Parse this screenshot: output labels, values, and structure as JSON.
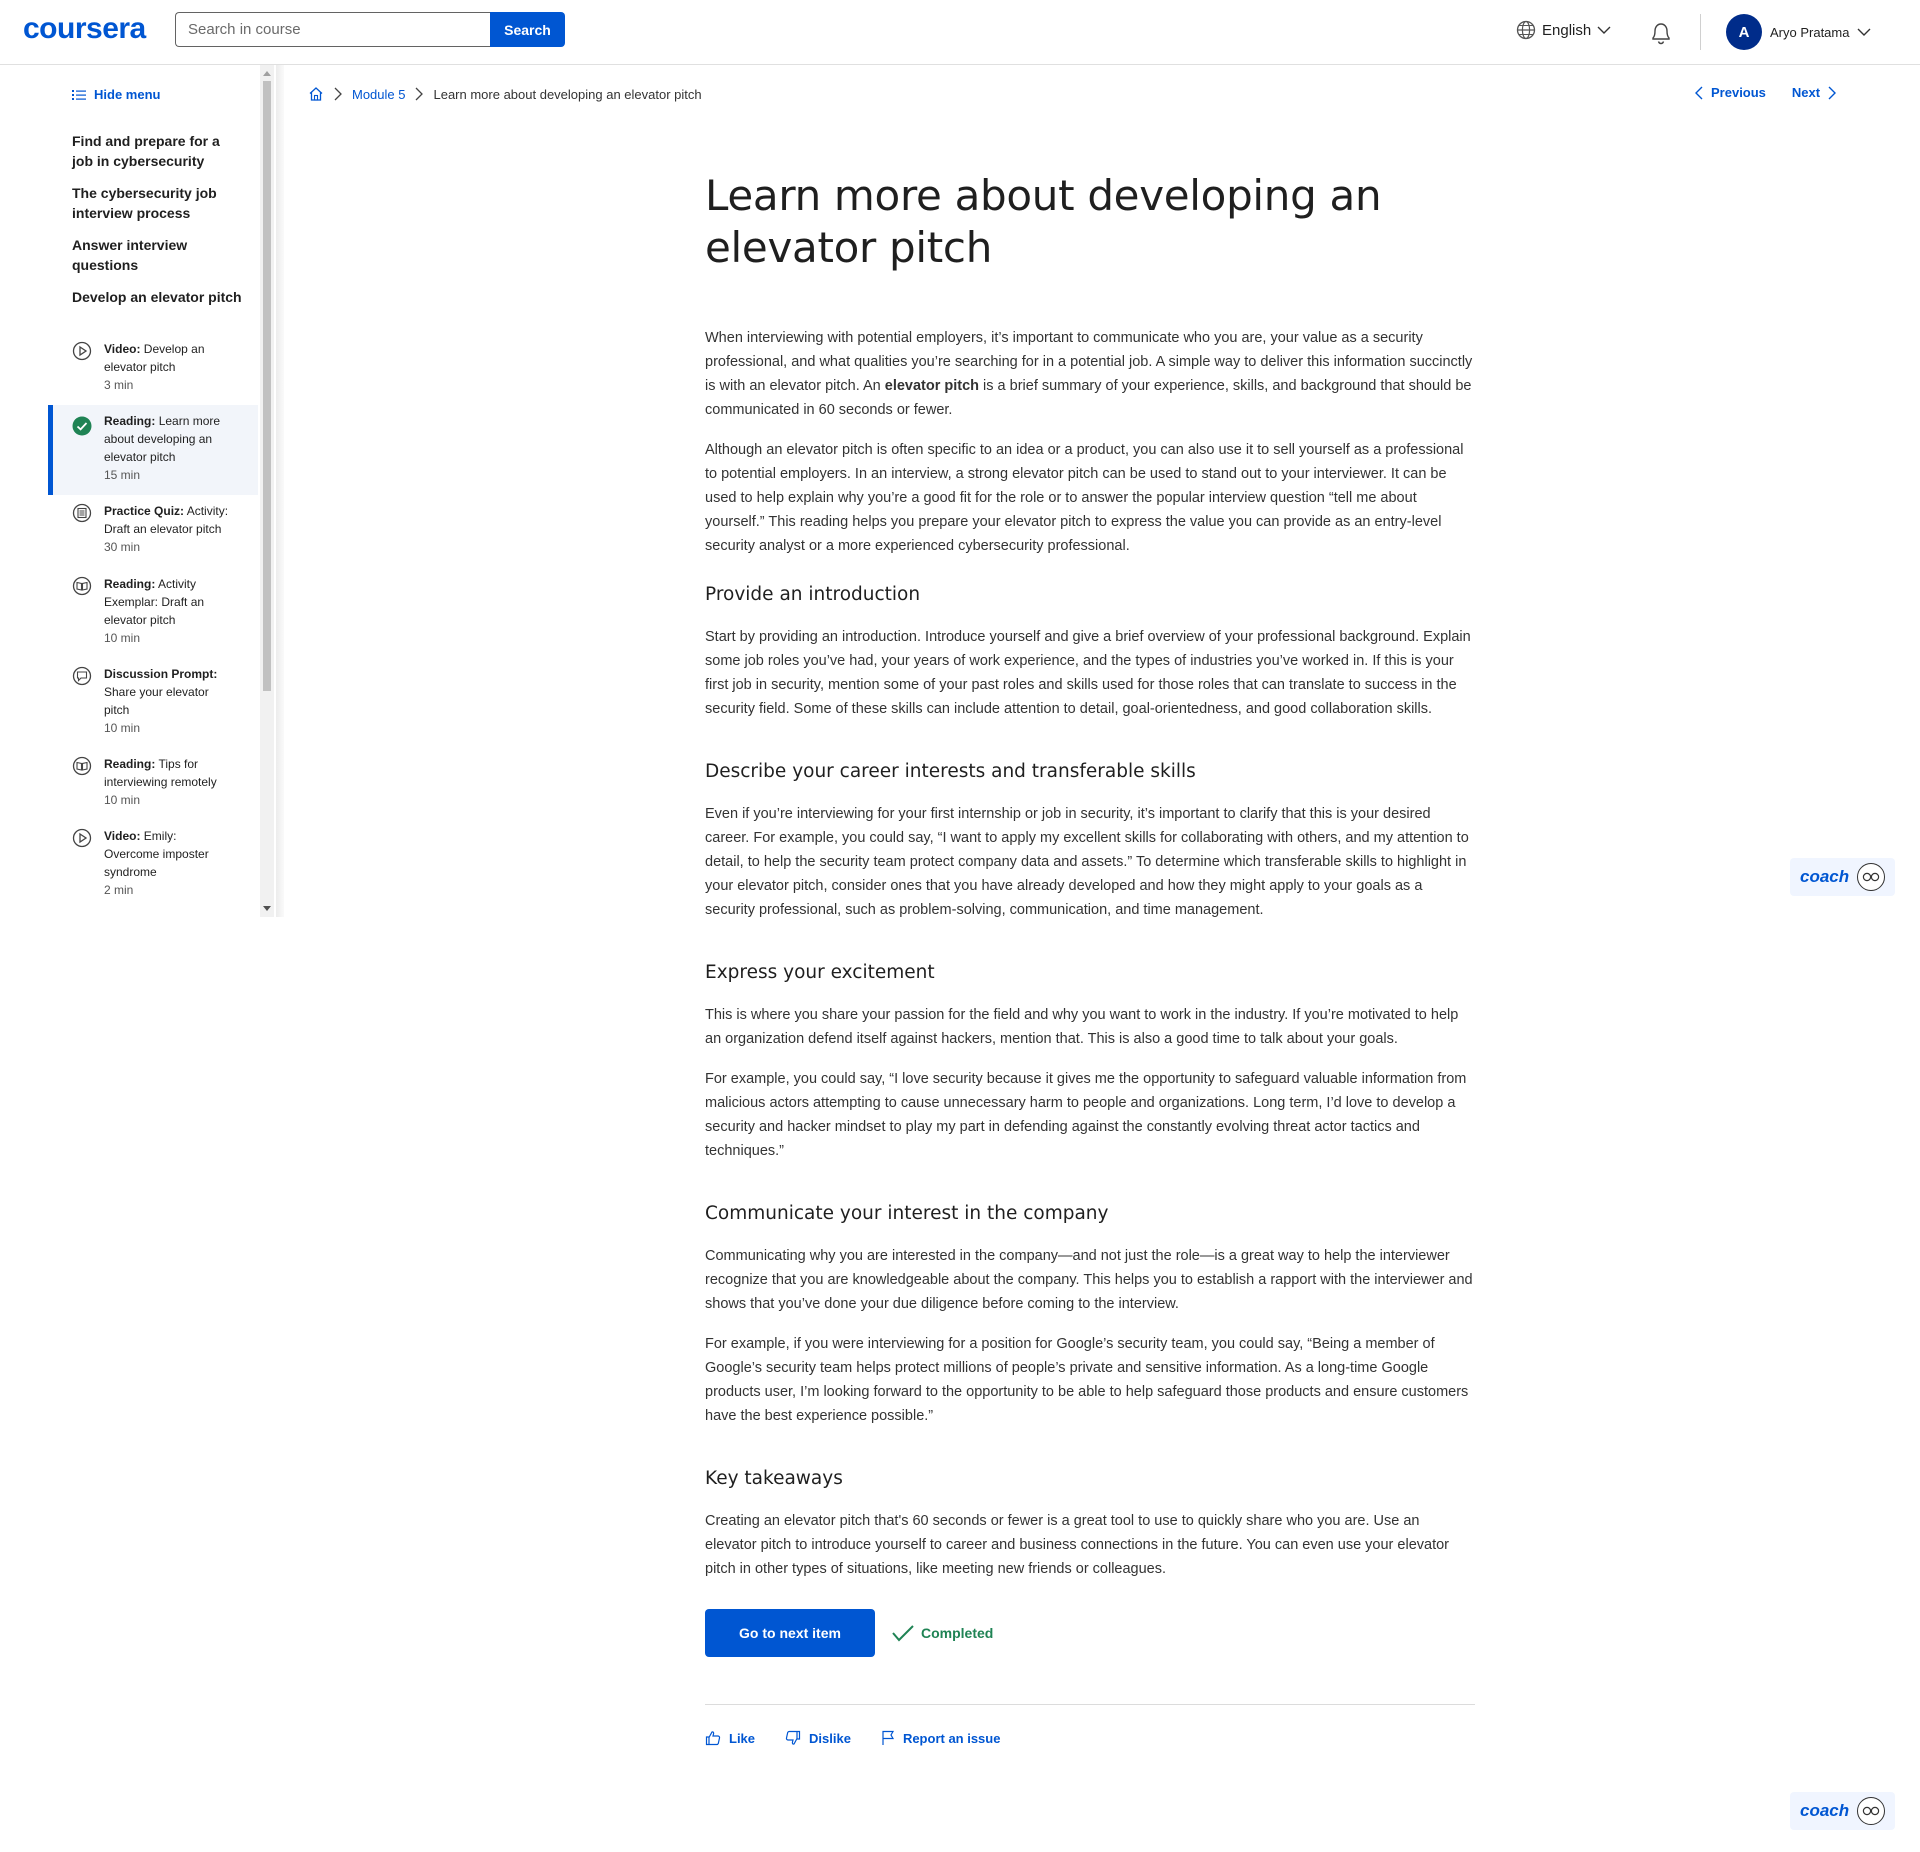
{
  "header": {
    "logo": "coursera",
    "search_placeholder": "Search in course",
    "search_button": "Search",
    "language": "English",
    "user_initial": "A",
    "user_name": "Aryo Pratama",
    "accent_color": "#0056d2"
  },
  "sidebar": {
    "hide_menu": "Hide menu",
    "modules": [
      "Find and prepare for a job in cybersecurity",
      "The cybersecurity job interview process",
      "Answer interview questions",
      "Develop an elevator pitch"
    ],
    "items": [
      {
        "type": "Video:",
        "title": "Develop an elevator pitch",
        "duration": "3 min",
        "icon": "play-icon"
      },
      {
        "type": "Reading:",
        "title": "Learn more about developing an elevator pitch",
        "duration": "15 min",
        "icon": "check-circle-icon",
        "active": true
      },
      {
        "type": "Practice Quiz:",
        "title": "Activity: Draft an elevator pitch",
        "duration": "30 min",
        "icon": "quiz-icon"
      },
      {
        "type": "Reading:",
        "title": "Activity Exemplar: Draft an elevator pitch",
        "duration": "10 min",
        "icon": "book-icon"
      },
      {
        "type": "Discussion Prompt:",
        "title": "Share your elevator pitch",
        "duration": "10 min",
        "icon": "discussion-icon"
      },
      {
        "type": "Reading:",
        "title": "Tips for interviewing remotely",
        "duration": "10 min",
        "icon": "book-icon"
      },
      {
        "type": "Video:",
        "title": "Emily: Overcome imposter syndrome",
        "duration": "2 min",
        "icon": "play-icon"
      }
    ]
  },
  "breadcrumb": {
    "module": "Module 5",
    "current": "Learn more about developing an elevator pitch"
  },
  "nav": {
    "previous": "Previous",
    "next": "Next"
  },
  "article": {
    "title": "Learn more about developing an elevator pitch",
    "intro_1_pre": "When interviewing with potential employers, it’s important to communicate who you are, your value as a security professional, and what qualities you’re searching for in a potential job. A simple way to deliver this information succinctly is with an elevator pitch. An ",
    "intro_1_bold": "elevator pitch",
    "intro_1_post": " is a brief summary of your experience, skills, and background that should be communicated in 60 seconds or fewer.",
    "intro_2": "Although an elevator pitch is often specific to an idea or a product, you can also use it to sell yourself as a professional to potential employers. In an interview, a strong elevator pitch can be used to stand out to your interviewer. It can be used to help explain why you’re a good fit for the role or to answer the popular interview question “tell me about yourself.” This reading helps you prepare your elevator pitch to express the value you can provide as an entry-level security analyst or a more experienced cybersecurity professional.",
    "h_intro": "Provide an introduction",
    "p_intro": "Start by providing an introduction. Introduce yourself and give a brief overview of your professional background. Explain some job roles you’ve had, your years of work experience, and the types of industries you’ve worked in. If this is your first job in security, mention some of your past roles and skills used for those roles that can translate to success in the security field. Some of these skills can include attention to detail, goal-orientedness, and good collaboration skills.",
    "h_career": "Describe your career interests and transferable skills",
    "p_career": "Even if you’re interviewing for your first internship or job in security, it’s important to clarify that this is your desired career. For example, you could say, “I want to apply my excellent skills for collaborating with others, and my attention to detail, to help the security team protect company data and assets.” To determine which transferable skills to highlight in your elevator pitch, consider ones that you have already developed and how they might apply to your goals as a security professional, such as problem-solving, communication, and time management.",
    "h_excite": "Express your excitement",
    "p_excite_1": "This is where you share your passion for the field and why you want to work in the industry. If you’re motivated to help an organization defend itself against hackers, mention that. This is also a good time to talk about your goals.",
    "p_excite_2": "For example, you could say, “I love security because it gives me the opportunity to safeguard valuable information from malicious actors attempting to cause unnecessary harm to people and organizations. Long term, I’d love to develop a security and hacker mindset to play my part in defending against the constantly evolving threat actor tactics and techniques.”",
    "h_company": "Communicate your interest in the company",
    "p_company_1": "Communicating why you are interested in the company—and not just the role—is a great way to help the interviewer recognize that you are knowledgeable about the company. This helps you to establish a rapport with the interviewer and shows that you’ve done your due diligence before coming to the interview.",
    "p_company_2": "For example, if you were interviewing for a position for Google’s security team, you could say, “Being a member of Google’s security team helps protect millions of people’s private and sensitive information. As a long-time Google products user, I’m looking forward to the opportunity to be able to help safeguard those products and ensure customers have the best experience possible.”",
    "h_key": "Key takeaways",
    "p_key": "Creating an elevator pitch that's 60 seconds or fewer is a great tool to use to quickly share who you are. Use an elevator pitch to introduce yourself to career and business connections in the future. You can even use your elevator pitch in other types of situations, like meeting new friends or colleagues."
  },
  "actions": {
    "next_item": "Go to next item",
    "completed": "Completed",
    "completed_color": "#1f8354"
  },
  "feedback": {
    "like": "Like",
    "dislike": "Dislike",
    "report": "Report an issue"
  },
  "coach": {
    "label": "coach"
  }
}
